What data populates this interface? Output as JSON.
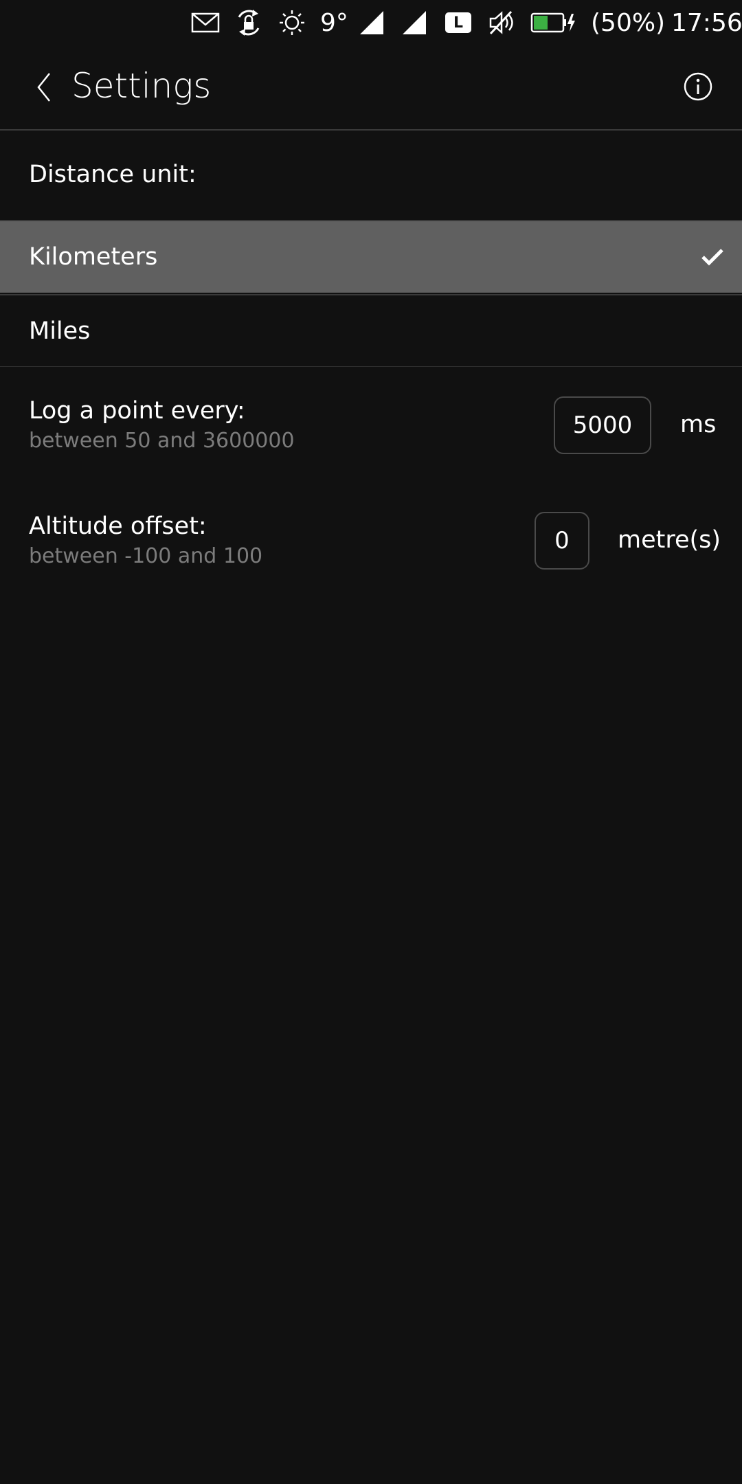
{
  "status_bar": {
    "icons": [
      "mail-icon",
      "rotation-lock-icon",
      "brightness-icon",
      "signal-icon",
      "signal-icon",
      "lte-icon",
      "speaker-muted-icon",
      "battery-charging-icon"
    ],
    "temperature": "9°",
    "network_type": "L",
    "battery_percent": "(50%)",
    "battery_level": 0.5,
    "battery_color": "#3cb043",
    "time": "17:56"
  },
  "header": {
    "title": "Settings"
  },
  "distance_unit": {
    "label": "Distance unit:",
    "options": [
      {
        "label": "Kilometers",
        "selected": true
      },
      {
        "label": "Miles",
        "selected": false
      }
    ]
  },
  "log_interval": {
    "label": "Log a point every:",
    "hint": "between 50 and 3600000",
    "value": "5000",
    "unit": "ms"
  },
  "altitude_offset": {
    "label": "Altitude offset:",
    "hint": "between -100 and 100",
    "value": "0",
    "unit": "metre(s)"
  },
  "colors": {
    "background": "#111111",
    "selected_row": "#606060",
    "hint_text": "#7c7c7c"
  }
}
